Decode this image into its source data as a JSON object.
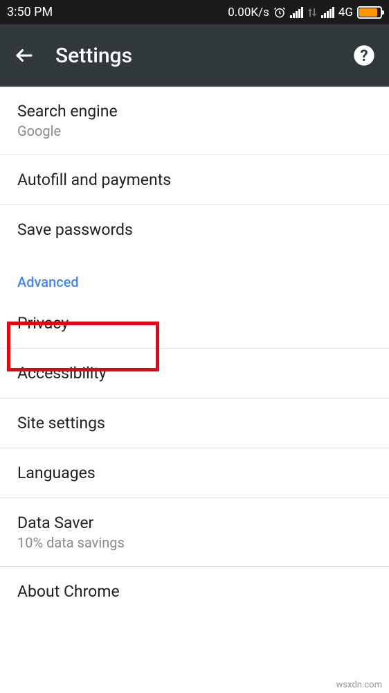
{
  "status_bar": {
    "time": "3:50 PM",
    "data_rate": "0.00K/s",
    "network_label": "4G"
  },
  "app_bar": {
    "title": "Settings"
  },
  "basics": {
    "search_engine": {
      "title": "Search engine",
      "subtitle": "Google"
    },
    "autofill": {
      "title": "Autofill and payments"
    },
    "save_passwords": {
      "title": "Save passwords"
    }
  },
  "advanced": {
    "header": "Advanced",
    "privacy": {
      "title": "Privacy"
    },
    "accessibility": {
      "title": "Accessibility"
    },
    "site_settings": {
      "title": "Site settings"
    },
    "languages": {
      "title": "Languages"
    },
    "data_saver": {
      "title": "Data Saver",
      "subtitle": "10% data savings"
    },
    "about_chrome": {
      "title": "About Chrome"
    }
  },
  "watermark": "wsxdn.com"
}
